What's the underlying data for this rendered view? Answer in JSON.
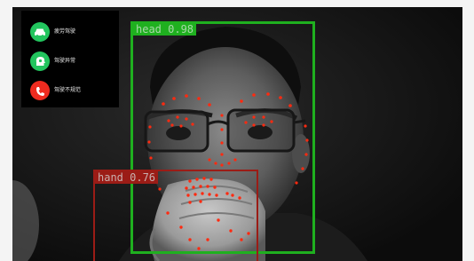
{
  "status_panel": {
    "items": [
      {
        "label": "疲劳驾驶",
        "icon": "car-icon",
        "color": "#22c55e"
      },
      {
        "label": "驾驶异常",
        "icon": "head-icon",
        "color": "#22c55e"
      },
      {
        "label": "驾驶不规范",
        "icon": "phone-icon",
        "color": "#ef2b1f"
      }
    ]
  },
  "detections": [
    {
      "label": "head 0.98",
      "class": "head",
      "confidence": 0.98,
      "color": "#1fb01f",
      "label_color": "#a8d8a8"
    },
    {
      "label": "hand 0.76",
      "class": "hand",
      "confidence": 0.76,
      "color": "#9b1c16",
      "label_color": "#c9b0ae"
    }
  ],
  "colors": {
    "landmark": "#ff2a10",
    "panel_background": "#000000",
    "page_background": "#f4f4f4"
  }
}
